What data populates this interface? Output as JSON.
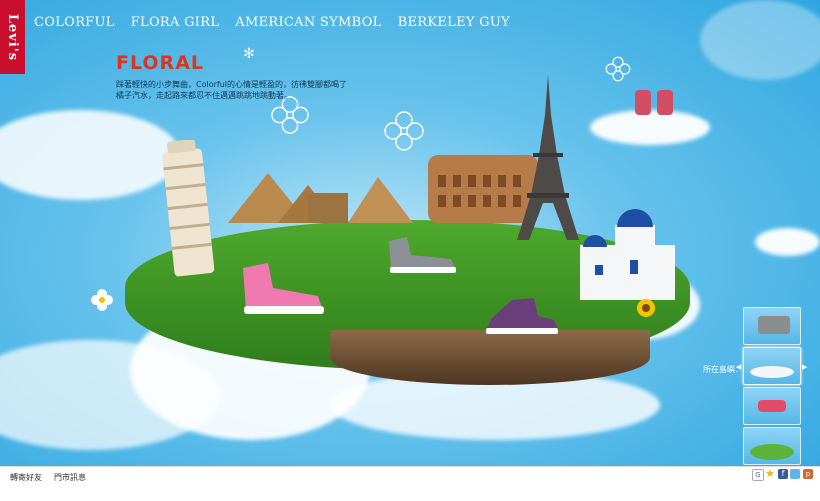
{
  "brand": {
    "logo_text": "Levi's"
  },
  "nav": {
    "items": [
      {
        "label": "COLORFUL"
      },
      {
        "label": "FLORA GIRL"
      },
      {
        "label": "AMERICAN SYMBOL"
      },
      {
        "label": "BERKELEY GUY"
      }
    ]
  },
  "section": {
    "title": "FLORAL",
    "desc_line1": "踩著輕快的小步舞曲，Colorful的心情是輕盈的，彷彿雙腳都喝了",
    "desc_line2": "橘子汽水，走起路來都忍不住邁邁跳跳地跳動著。"
  },
  "location_picker": {
    "label": "所在島嶼：",
    "thumbs": 4,
    "active": 1
  },
  "footer": {
    "links": [
      {
        "label": "轉寄好友"
      },
      {
        "label": "門市訊息"
      }
    ]
  },
  "share_icons": [
    "google-icon",
    "star-icon",
    "facebook-icon",
    "twitter-icon",
    "plurk-icon"
  ],
  "colors": {
    "sky": "#2ea6e0",
    "logo_red": "#c8102e",
    "title_red": "#d8361f",
    "grass": "#4ea92c"
  }
}
